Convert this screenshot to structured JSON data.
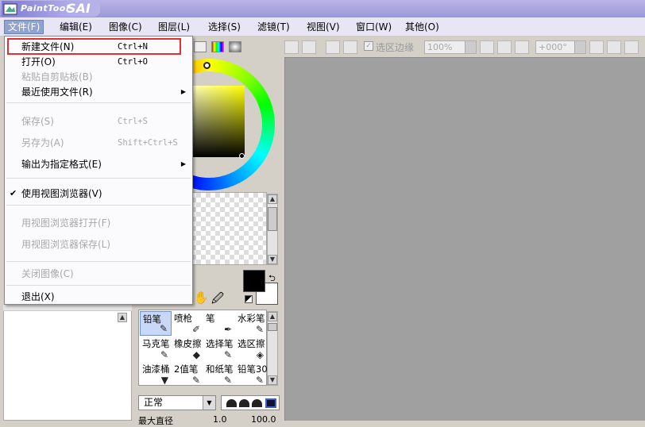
{
  "app": {
    "logo_brand": "PaintTool",
    "logo_name": "SAI"
  },
  "menubar": [
    {
      "label": "文件(F)",
      "active": true
    },
    {
      "label": "编辑(E)"
    },
    {
      "label": "图像(C)"
    },
    {
      "label": "图层(L)"
    },
    {
      "label": "选择(S)"
    },
    {
      "label": "滤镜(T)"
    },
    {
      "label": "视图(V)"
    },
    {
      "label": "窗口(W)"
    },
    {
      "label": "其他(O)"
    }
  ],
  "file_menu": [
    {
      "label": "新建文件(N)",
      "shortcut": "Ctrl+N",
      "enabled": true
    },
    {
      "label": "打开(O)",
      "shortcut": "Ctrl+O",
      "enabled": true
    },
    {
      "label": "粘贴自剪贴板(B)",
      "enabled": false
    },
    {
      "label": "最近使用文件(R)",
      "submenu": true,
      "enabled": true
    },
    {
      "label": "保存(S)",
      "shortcut": "Ctrl+S",
      "enabled": false
    },
    {
      "label": "另存为(A)",
      "shortcut": "Shift+Ctrl+S",
      "enabled": false
    },
    {
      "label": "输出为指定格式(E)",
      "submenu": true,
      "enabled": true
    },
    {
      "label": "使用视图浏览器(V)",
      "checked": true,
      "enabled": true
    },
    {
      "label": "用视图浏览器打开(F)",
      "enabled": false
    },
    {
      "label": "用视图浏览器保存(L)",
      "enabled": false
    },
    {
      "label": "关闭图像(C)",
      "enabled": false
    },
    {
      "label": "退出(X)",
      "enabled": true
    }
  ],
  "toolbar": {
    "selection_edge_label": "选区边缘",
    "zoom_value": "100%",
    "rotation_value": "+000°"
  },
  "colors": {
    "foreground": "#000000",
    "background": "#ffffff",
    "highlight": "#e03030"
  },
  "brushes": [
    {
      "label": "铅笔",
      "icon": "pencil-icon",
      "selected": true
    },
    {
      "label": "喷枪",
      "icon": "airbrush-icon"
    },
    {
      "label": "笔",
      "icon": "pen-icon"
    },
    {
      "label": "水彩笔",
      "icon": "watercolor-icon"
    },
    {
      "label": "马克笔",
      "icon": "marker-icon"
    },
    {
      "label": "橡皮擦",
      "icon": "eraser-icon"
    },
    {
      "label": "选择笔",
      "icon": "select-pen-icon"
    },
    {
      "label": "选区擦",
      "icon": "select-eraser-icon"
    },
    {
      "label": "油漆桶",
      "icon": "bucket-icon"
    },
    {
      "label": "2值笔",
      "icon": "binary-pen-icon"
    },
    {
      "label": "和纸笔",
      "icon": "washi-pen-icon"
    },
    {
      "label": "铅笔30",
      "icon": "pencil-icon"
    }
  ],
  "brush_settings": {
    "blend_mode": "正常",
    "size_label": "最大直径",
    "size_value": "1.0",
    "size_max": "100.0"
  }
}
